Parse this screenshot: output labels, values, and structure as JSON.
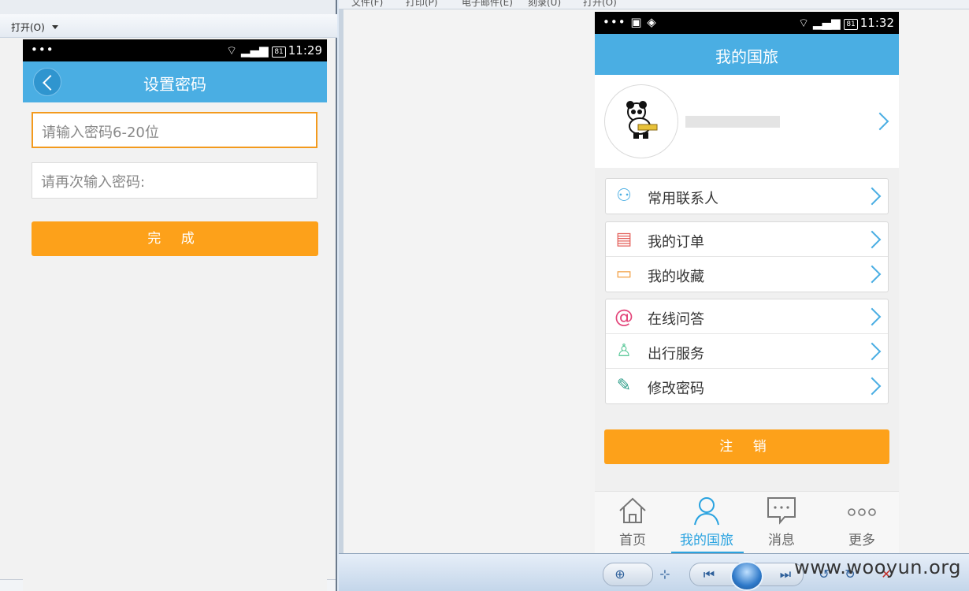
{
  "left_viewer": {
    "toolbar_open": "打开(O)",
    "phone": {
      "status": {
        "dots": "•••",
        "battery": "81",
        "time": "11:29"
      },
      "title": "设置密码",
      "password_placeholder": "请输入密码6-20位",
      "confirm_placeholder": "请再次输入密码:",
      "done_label": "完 成"
    }
  },
  "right_viewer": {
    "menu": [
      "文件(F)",
      "打印(P)",
      "电子邮件(E)",
      "刻录(U)",
      "打开(O)"
    ],
    "watermark": "www.wooyun.org",
    "phone": {
      "status": {
        "dots": "•••",
        "battery": "81",
        "time": "11:32"
      },
      "title": "我的国旅",
      "groups": [
        [
          {
            "label": "常用联系人",
            "icon": "contacts-icon"
          }
        ],
        [
          {
            "label": "我的订单",
            "icon": "order-icon"
          },
          {
            "label": "我的收藏",
            "icon": "folder-icon"
          }
        ],
        [
          {
            "label": "在线问答",
            "icon": "at-icon"
          },
          {
            "label": "出行服务",
            "icon": "user-icon"
          },
          {
            "label": "修改密码",
            "icon": "edit-icon"
          }
        ]
      ],
      "logout_label": "注 销",
      "tabs": [
        {
          "label": "首页",
          "icon": "home-icon"
        },
        {
          "label": "我的国旅",
          "icon": "person-icon",
          "active": true
        },
        {
          "label": "消息",
          "icon": "message-icon"
        },
        {
          "label": "更多",
          "icon": "more-icon"
        }
      ]
    }
  },
  "colors": {
    "nav_blue": "#4aaee3",
    "orange": "#fda11a",
    "active_tab": "#2aa3e0"
  }
}
